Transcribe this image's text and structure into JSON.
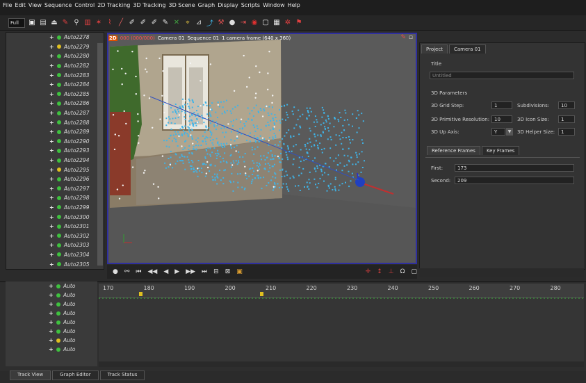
{
  "menu": [
    "File",
    "Edit",
    "View",
    "Sequence",
    "Control",
    "2D Tracking",
    "3D Tracking",
    "3D Scene",
    "Graph",
    "Display",
    "Scripts",
    "Window",
    "Help"
  ],
  "toolbar": {
    "mode_value": "Full"
  },
  "tree": {
    "items": [
      {
        "label": "Auto2278",
        "color": "#3fc13f"
      },
      {
        "label": "Auto2279",
        "color": "#e0c020"
      },
      {
        "label": "Auto2280",
        "color": "#3fc13f"
      },
      {
        "label": "Auto2282",
        "color": "#3fc13f"
      },
      {
        "label": "Auto2283",
        "color": "#3fc13f"
      },
      {
        "label": "Auto2284",
        "color": "#3fc13f"
      },
      {
        "label": "Auto2285",
        "color": "#3fc13f"
      },
      {
        "label": "Auto2286",
        "color": "#3fc13f"
      },
      {
        "label": "Auto2287",
        "color": "#3fc13f"
      },
      {
        "label": "Auto2288",
        "color": "#3fc13f"
      },
      {
        "label": "Auto2289",
        "color": "#3fc13f"
      },
      {
        "label": "Auto2290",
        "color": "#3fc13f"
      },
      {
        "label": "Auto2293",
        "color": "#3fc13f"
      },
      {
        "label": "Auto2294",
        "color": "#3fc13f"
      },
      {
        "label": "Auto2295",
        "color": "#e0c020"
      },
      {
        "label": "Auto2296",
        "color": "#3fc13f"
      },
      {
        "label": "Auto2297",
        "color": "#3fc13f"
      },
      {
        "label": "Auto2298",
        "color": "#3fc13f"
      },
      {
        "label": "Auto2299",
        "color": "#3fc13f"
      },
      {
        "label": "Auto2300",
        "color": "#3fc13f"
      },
      {
        "label": "Auto2301",
        "color": "#3fc13f"
      },
      {
        "label": "Auto2302",
        "color": "#3fc13f"
      },
      {
        "label": "Auto2303",
        "color": "#3fc13f"
      },
      {
        "label": "Auto2304",
        "color": "#3fc13f"
      },
      {
        "label": "Auto2305",
        "color": "#3fc13f"
      }
    ]
  },
  "viewport": {
    "badge": "2D",
    "frame": "000 (000/000)",
    "camera": "Camera 01",
    "sequence": "Sequence 01",
    "status": "1 camera frame (640 x 360)"
  },
  "right_panel": {
    "tabs": [
      "Project",
      "Camera 01"
    ],
    "title_label": "Title",
    "title_value": "Untitled",
    "params_heading": "3D Parameters",
    "grid_step_label": "3D Grid Step:",
    "grid_step_value": "1",
    "subdivisions_label": "Subdivisions:",
    "subdivisions_value": "10",
    "primitive_res_label": "3D Primitive Resolution:",
    "primitive_res_value": "10",
    "icon_size_label": "3D Icon Size:",
    "icon_size_value": "1",
    "up_axis_label": "3D Up Axis:",
    "up_axis_value": "Y",
    "helper_size_label": "3D Helper Size:",
    "helper_size_value": "1",
    "ref_tabs": [
      "Reference Frames",
      "Key Frames"
    ],
    "first_label": "First:",
    "first_value": "173",
    "second_label": "Second:",
    "second_value": "209"
  },
  "timeline": {
    "ticks": [
      "170",
      "180",
      "190",
      "200",
      "210",
      "220",
      "230",
      "240",
      "250",
      "260",
      "270",
      "280"
    ],
    "tree_items": [
      "Auto",
      "Auto",
      "Auto",
      "Auto",
      "Auto",
      "Auto",
      "Auto",
      "Auto"
    ]
  },
  "bottom_tabs": [
    "Track View",
    "Graph Editor",
    "Track Status"
  ]
}
